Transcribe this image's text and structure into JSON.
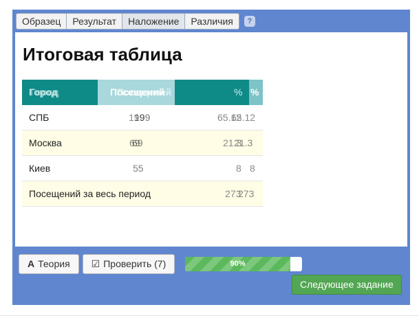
{
  "tabs": [
    "Образец",
    "Результат",
    "Наложение",
    "Различия"
  ],
  "help_label": "?",
  "panel": {
    "title": "Итоговая таблица",
    "table": {
      "headers": {
        "city": "Город",
        "city_ghost": "Город",
        "visits": "Посещений",
        "visits_ghost": "Посещений",
        "pct": "%",
        "pct_ghost": "%"
      },
      "rows": [
        {
          "city": "СПБ",
          "visits_a": "199",
          "visits_b": "199",
          "pct_a": "65.12",
          "pct_b": "65.12"
        },
        {
          "city": "Москва",
          "visits_a": "69",
          "visits_b": "69",
          "pct_a": "21.3",
          "pct_b": "21.3"
        },
        {
          "city": "Киев",
          "visits_a": "55",
          "visits_b": "55",
          "pct_a": "8",
          "pct_b": "8"
        }
      ],
      "footer": {
        "label": "Посещений за весь период",
        "total_a": "273",
        "total_b": "273"
      }
    }
  },
  "buttons": {
    "theory": "Теория",
    "theory_icon": "A",
    "check": "Проверить (7)",
    "check_icon": "☑",
    "next": "Следующее задание"
  },
  "progress": {
    "label": "90%",
    "value": 90
  }
}
